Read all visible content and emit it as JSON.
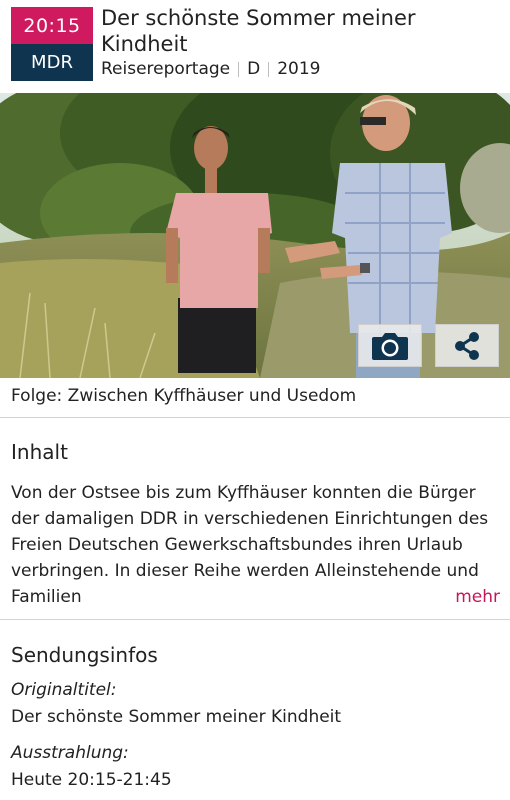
{
  "header": {
    "time": "20:15",
    "channel": "MDR",
    "title": "Der schönste Sommer meiner Kindheit",
    "genre": "Reisereportage",
    "country": "D",
    "year": "2019"
  },
  "hero": {
    "camera_icon": "camera-icon",
    "share_icon": "share-icon"
  },
  "episode": "Folge: Zwischen Kyffhäuser und Usedom",
  "content": {
    "heading": "Inhalt",
    "description": "Von der Ostsee bis zum Kyffhäuser konnten die Bürger der damaligen DDR in verschiedenen Einrichtungen des Freien Deutschen Gewerkschaftsbundes ihren Urlaub verbringen. In dieser Reihe werden Alleinstehende und Familien",
    "more_label": "mehr"
  },
  "info": {
    "heading": "Sendungsinfos",
    "original_title_label": "Originaltitel:",
    "original_title": "Der schönste Sommer meiner Kindheit",
    "broadcast_label": "Ausstrahlung:",
    "broadcast": "Heute 20:15-21:45"
  },
  "colors": {
    "time_badge": "#d01a60",
    "channel_badge": "#0f3450",
    "link": "#c2185b"
  }
}
